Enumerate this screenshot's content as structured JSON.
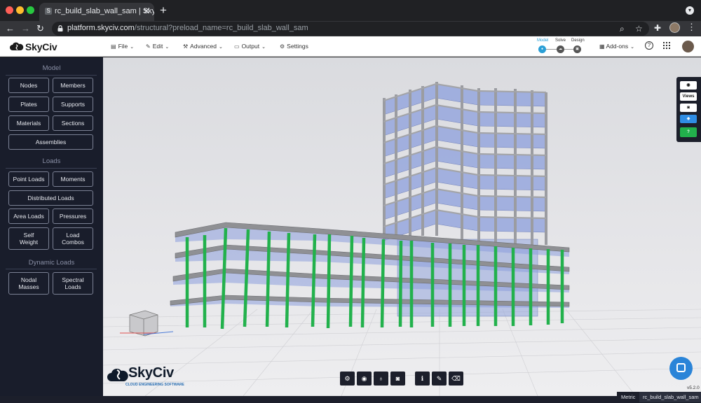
{
  "browser": {
    "tab_title": "rc_build_slab_wall_sam | SkyCiv",
    "tab_close": "✕",
    "new_tab": "+",
    "url_host": "platform.skyciv.com",
    "url_path": "/structural?preload_name=rc_build_slab_wall_sam"
  },
  "app": {
    "logo_text": "SkyCiv",
    "menu": {
      "file": "File",
      "edit": "Edit",
      "advanced": "Advanced",
      "output": "Output",
      "settings": "Settings"
    },
    "stages": {
      "model": "Model",
      "solve": "Solve",
      "design": "Design"
    },
    "addons": "Add-ons",
    "help": "?"
  },
  "sidebar": {
    "model_heading": "Model",
    "nodes": "Nodes",
    "members": "Members",
    "plates": "Plates",
    "supports": "Supports",
    "materials": "Materials",
    "sections": "Sections",
    "assemblies": "Assemblies",
    "loads_heading": "Loads",
    "point_loads": "Point Loads",
    "moments": "Moments",
    "distributed_loads": "Distributed Loads",
    "area_loads": "Area Loads",
    "pressures": "Pressures",
    "self_weight_1": "Self",
    "self_weight_2": "Weight",
    "load_combos_1": "Load",
    "load_combos_2": "Combos",
    "dynamic_heading": "Dynamic Loads",
    "nodal_masses_1": "Nodal",
    "nodal_masses_2": "Masses",
    "spectral_loads_1": "Spectral",
    "spectral_loads_2": "Loads"
  },
  "viewport": {
    "logo_text": "SkyCiv",
    "logo_sub": "CLOUD ENGINEERING SOFTWARE",
    "right_panel": {
      "views": "Views",
      "help": "?"
    },
    "version": "v5.2.0"
  },
  "status": {
    "units": "Metric",
    "file": "rc_build_slab_wall_sam"
  },
  "colors": {
    "sidebar_bg": "#191d2b",
    "column_green": "#22b14c",
    "slab_grey": "#8f9094",
    "panel_blue": "#7c90d6",
    "accent_blue": "#2a9fd6"
  }
}
